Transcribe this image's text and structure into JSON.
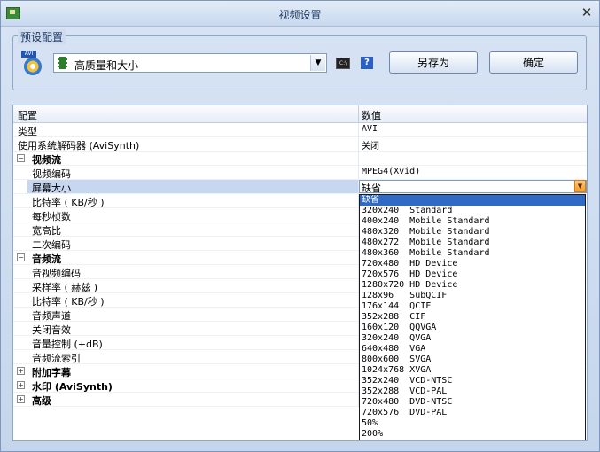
{
  "window": {
    "title": "视频设置"
  },
  "preset": {
    "legend": "预设配置",
    "avi_badge": "AVI",
    "selected": "高质量和大小",
    "cmd_label": "C:\\",
    "help_label": "?",
    "save_as_label": "另存为",
    "ok_label": "确定"
  },
  "grid": {
    "header_name": "配置",
    "header_value": "数值",
    "rows": [
      {
        "name": "类型",
        "value": "AVI",
        "level": 0
      },
      {
        "name": "使用系统解码器 (AviSynth)",
        "value": "关闭",
        "level": 0
      },
      {
        "name": "视频流",
        "value": "",
        "level": 0,
        "category": true,
        "expander": "−"
      },
      {
        "name": "视频编码",
        "value": "MPEG4(Xvid)",
        "level": 1
      },
      {
        "name": "屏幕大小",
        "value": "缺省",
        "level": 1,
        "selected": true
      },
      {
        "name": "比特率 ( KB/秒 )",
        "value": "",
        "level": 1
      },
      {
        "name": "每秒桢数",
        "value": "",
        "level": 1
      },
      {
        "name": "宽高比",
        "value": "",
        "level": 1
      },
      {
        "name": "二次编码",
        "value": "",
        "level": 1
      },
      {
        "name": "音频流",
        "value": "",
        "level": 0,
        "category": true,
        "expander": "−"
      },
      {
        "name": "音视频编码",
        "value": "",
        "level": 1
      },
      {
        "name": "采样率 ( 赫兹 )",
        "value": "",
        "level": 1
      },
      {
        "name": "比特率 ( KB/秒 )",
        "value": "",
        "level": 1
      },
      {
        "name": "音频声道",
        "value": "",
        "level": 1
      },
      {
        "name": "关闭音效",
        "value": "",
        "level": 1
      },
      {
        "name": "音量控制 (+dB)",
        "value": "",
        "level": 1
      },
      {
        "name": "音频流索引",
        "value": "",
        "level": 1
      },
      {
        "name": "附加字幕",
        "value": "",
        "level": 0,
        "category": true,
        "expander": "+"
      },
      {
        "name": "水印 (AviSynth)",
        "value": "",
        "level": 0,
        "category": true,
        "expander": "+"
      },
      {
        "name": "高级",
        "value": "",
        "level": 0,
        "category": true,
        "expander": "+"
      }
    ]
  },
  "dropdown": {
    "selected_index": 0,
    "options": [
      "缺省",
      "320x240  Standard",
      "400x240  Mobile Standard",
      "480x320  Mobile Standard",
      "480x272  Mobile Standard",
      "480x360  Mobile Standard",
      "720x480  HD Device",
      "720x576  HD Device",
      "1280x720 HD Device",
      "128x96   SubQCIF",
      "176x144  QCIF",
      "352x288  CIF",
      "160x120  QQVGA",
      "320x240  QVGA",
      "640x480  VGA",
      "800x600  SVGA",
      "1024x768 XVGA",
      "352x240  VCD-NTSC",
      "352x288  VCD-PAL",
      "720x480  DVD-NTSC",
      "720x576  DVD-PAL",
      "50%",
      "200%"
    ]
  },
  "colors": {
    "selection": "#316ac5",
    "row_highlight": "#c6d7ef",
    "dropdown_arrow": "#f29a2e"
  }
}
